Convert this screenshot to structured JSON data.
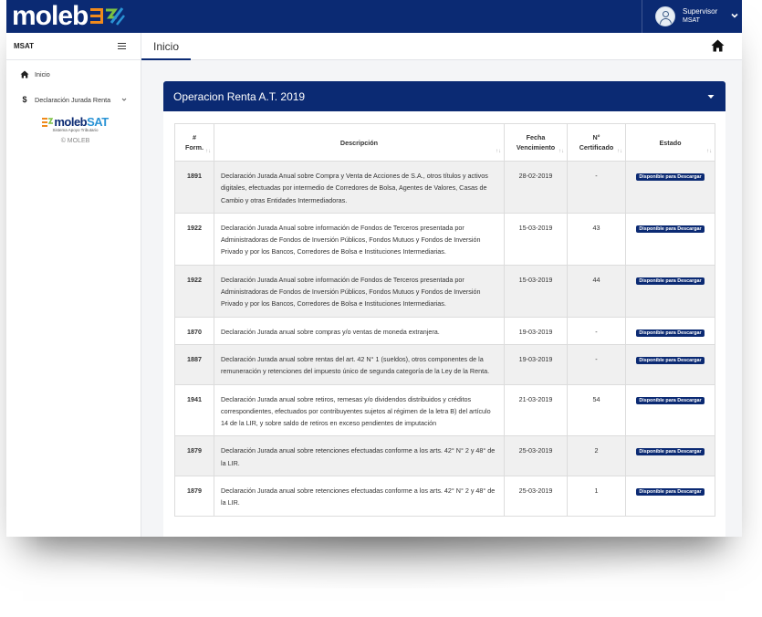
{
  "header": {
    "brand": "moleb",
    "user_name": "Supervisor",
    "user_role": "MSAT"
  },
  "sidebar": {
    "title": "MSAT",
    "items": [
      {
        "label": "Inicio",
        "icon": "home-icon"
      },
      {
        "label": "Declaración Jurada Renta",
        "icon": "dollar-icon"
      }
    ],
    "logo_moleb": "moleb",
    "logo_sat": "SAT",
    "logo_sub": "Sistema Apoyo Tributario",
    "copyright": "© MOLEB"
  },
  "breadcrumb": {
    "current": "Inicio"
  },
  "panel": {
    "title": "Operacion Renta A.T. 2019",
    "columns": {
      "form_a": "#",
      "form_b": "Form.",
      "desc": "Descripción",
      "date_a": "Fecha",
      "date_b": "Vencimiento",
      "cert_a": "N°",
      "cert_b": "Certificado",
      "status": "Estado"
    },
    "rows": [
      {
        "form": "1891",
        "desc": "Declaración Jurada Anual sobre Compra y Venta de Acciones de S.A., otros títulos y activos digitales, efectuadas por intermedio de Corredores de Bolsa, Agentes de Valores, Casas de Cambio y otras Entidades Intermediadoras.",
        "date": "28-02-2019",
        "cert": "-",
        "status": "Disponible para Descargar"
      },
      {
        "form": "1922",
        "desc": "Declaración Jurada Anual sobre información de Fondos de Terceros presentada por Administradoras de Fondos de Inversión Públicos, Fondos Mutuos y Fondos de Inversión Privado  y por los Bancos, Corredores de Bolsa e Instituciones Intermediarias.",
        "date": "15-03-2019",
        "cert": "43",
        "status": "Disponible para Descargar"
      },
      {
        "form": "1922",
        "desc": "Declaración Jurada Anual sobre información de Fondos de Terceros presentada por Administradoras de Fondos de Inversión Públicos, Fondos Mutuos y Fondos de Inversión Privado  y por los Bancos, Corredores de Bolsa e Instituciones Intermediarias.",
        "date": "15-03-2019",
        "cert": "44",
        "status": "Disponible para Descargar"
      },
      {
        "form": "1870",
        "desc": "Declaración Jurada anual sobre compras y/o ventas de moneda extranjera.",
        "date": "19-03-2019",
        "cert": "-",
        "status": "Disponible para Descargar"
      },
      {
        "form": "1887",
        "desc": "Declaración Jurada anual sobre rentas del art. 42 N° 1 (sueldos), otros componentes de la remuneración y retenciones del impuesto único de segunda categoría de la Ley de la Renta.",
        "date": "19-03-2019",
        "cert": "-",
        "status": "Disponible para Descargar"
      },
      {
        "form": "1941",
        "desc": "Declaración Jurada anual sobre retiros, remesas y/o dividendos distribuidos y créditos correspondientes, efectuados por contribuyentes sujetos al régimen de la letra B) del artículo 14 de la LIR,  y sobre saldo de retiros en exceso pendientes de imputación",
        "date": "21-03-2019",
        "cert": "54",
        "status": "Disponible para Descargar"
      },
      {
        "form": "1879",
        "desc": "Declaración Jurada anual sobre retenciones efectuadas conforme a los arts. 42° N° 2 y 48° de la LIR.",
        "date": "25-03-2019",
        "cert": "2",
        "status": "Disponible para Descargar"
      },
      {
        "form": "1879",
        "desc": "Declaración Jurada anual sobre retenciones efectuadas conforme a los arts. 42° N° 2 y 48° de la LIR.",
        "date": "25-03-2019",
        "cert": "1",
        "status": "Disponible para Descargar"
      }
    ]
  },
  "colors": {
    "navy": "#0b2a73",
    "row_alt": "#f0f0f0",
    "logo_orange": "#f08a1c",
    "logo_green": "#7cc142",
    "logo_blue": "#2a93d5"
  }
}
